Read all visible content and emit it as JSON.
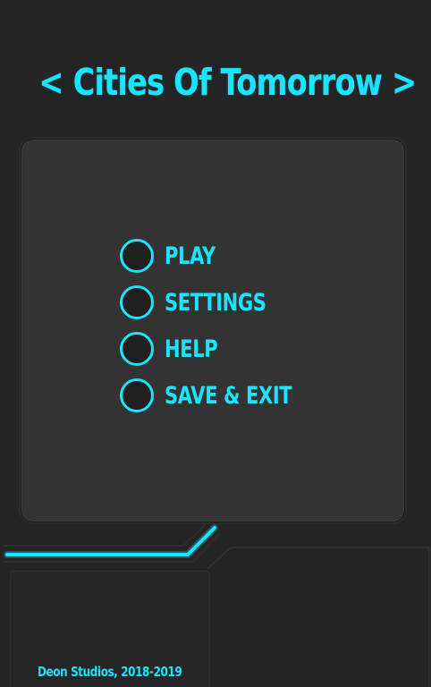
{
  "app": {
    "title": "< Cities Of Tomorrow >"
  },
  "menu": {
    "items": [
      {
        "label": "PLAY"
      },
      {
        "label": "SETTINGS"
      },
      {
        "label": "HELP"
      },
      {
        "label": "SAVE & EXIT"
      }
    ]
  },
  "footer": {
    "credit": "Deon Studios, 2018-2019"
  },
  "colors": {
    "accent": "#1ae4ff",
    "background": "#242424",
    "panel": "#333333"
  }
}
